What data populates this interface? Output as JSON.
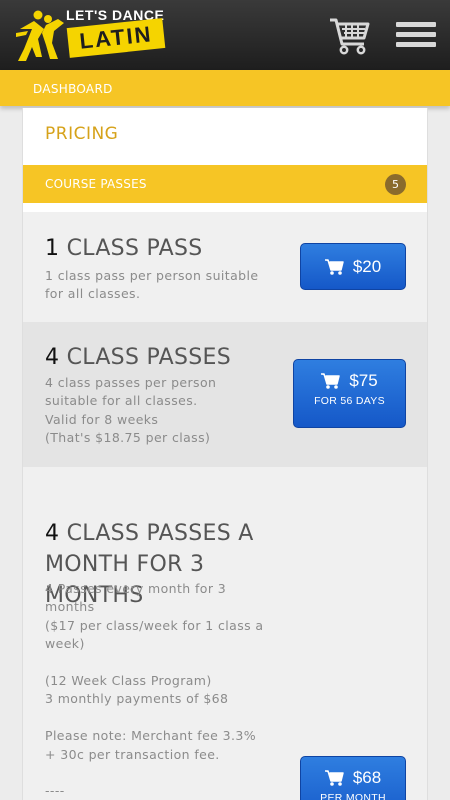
{
  "header": {
    "logo_top": "LET'S DANCE",
    "logo_bottom": "LATIN",
    "icons": [
      "dancers-logo-icon",
      "cart-icon",
      "hamburger-menu-icon"
    ]
  },
  "breadcrumb": "DASHBOARD",
  "page_title": "PRICING",
  "section": {
    "label": "COURSE PASSES",
    "count": "5"
  },
  "items": [
    {
      "title_num": "1",
      "title_rest": " CLASS PASS",
      "description": "1 class pass per person suitable\nfor all classes.",
      "price": "$20",
      "price_note": ""
    },
    {
      "title_num": "4",
      "title_rest": " CLASS PASSES",
      "description": "4 class passes per person\nsuitable for all classes.\nValid for 8 weeks\n(That's $18.75 per class)",
      "price": "$75",
      "price_note": "FOR 56 DAYS"
    },
    {
      "title_num": "4",
      "title_rest": " CLASS PASSES A\nMONTH FOR 3\nMONTHS",
      "description": "4 Passes every month for 3\nmonths\n($17 per class/week for 1 class a\nweek)\n\n(12 Week Class Program)\n3 monthly payments of $68\n\nPlease note: Merchant fee 3.3%\n+ 30c per transaction fee.\n\n----",
      "price": "$68",
      "price_note": "PER MONTH"
    }
  ],
  "colors": {
    "header_bg": "#2a2a2a",
    "accent_yellow": "#f6c525",
    "pricing_title": "#d6a21a",
    "button_blue": "#1f6ad6",
    "badge_bg": "#8a6b2c"
  }
}
